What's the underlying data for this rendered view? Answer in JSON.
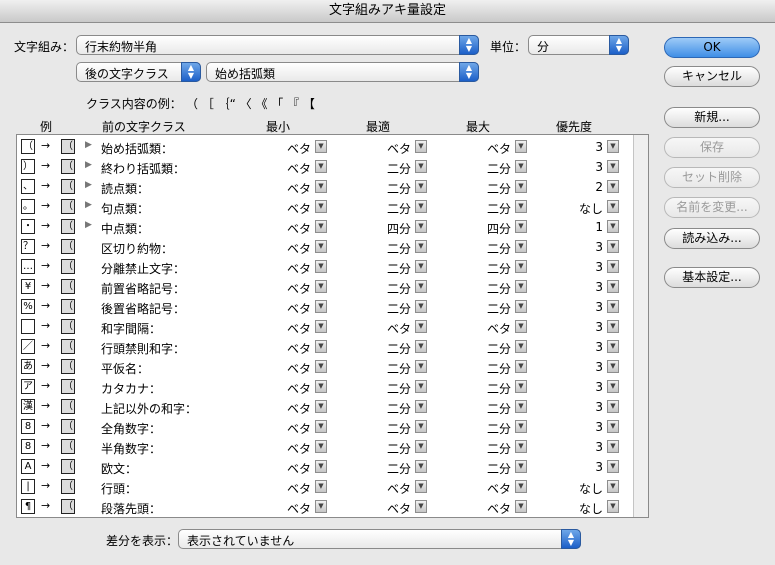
{
  "window": {
    "title": "文字組みアキ量設定"
  },
  "top": {
    "mojigumi_label": "文字組み：",
    "mojigumi_value": "行末約物半角",
    "unit_label": "単位：",
    "unit_value": "分",
    "after_class_value": "後の文字クラス",
    "class_value": "始め括弧類",
    "example_label": "クラス内容の例：",
    "example_chars": "（ ［ ｛“ 〈 《 「 『 【"
  },
  "buttons": {
    "ok": "OK",
    "cancel": "キャンセル",
    "new": "新規...",
    "save": "保存",
    "delete_set": "セット削除",
    "rename": "名前を変更...",
    "load": "読み込み...",
    "basic": "基本設定..."
  },
  "columns": {
    "example": "例",
    "prev_class": "前の文字クラス",
    "min": "最小",
    "opt": "最適",
    "max": "最大",
    "priority": "優先度"
  },
  "rows": [
    {
      "glyph": "（",
      "label": "始め括弧類：",
      "expand": true,
      "min": "ベタ",
      "opt": "ベタ",
      "max": "ベタ",
      "priority": "3"
    },
    {
      "glyph": "）",
      "label": "終わり括弧類：",
      "expand": true,
      "min": "ベタ",
      "opt": "二分",
      "max": "二分",
      "priority": "3"
    },
    {
      "glyph": "、",
      "label": "読点類：",
      "expand": true,
      "min": "ベタ",
      "opt": "二分",
      "max": "二分",
      "priority": "2"
    },
    {
      "glyph": "。",
      "label": "句点類：",
      "expand": true,
      "min": "ベタ",
      "opt": "二分",
      "max": "二分",
      "priority": "なし"
    },
    {
      "glyph": "・",
      "label": "中点類：",
      "expand": true,
      "min": "ベタ",
      "opt": "四分",
      "max": "四分",
      "priority": "1"
    },
    {
      "glyph": "？",
      "label": "区切り約物：",
      "expand": false,
      "min": "ベタ",
      "opt": "二分",
      "max": "二分",
      "priority": "3"
    },
    {
      "glyph": "…",
      "label": "分離禁止文字：",
      "expand": false,
      "min": "ベタ",
      "opt": "二分",
      "max": "二分",
      "priority": "3"
    },
    {
      "glyph": "¥",
      "label": "前置省略記号：",
      "expand": false,
      "min": "ベタ",
      "opt": "二分",
      "max": "二分",
      "priority": "3"
    },
    {
      "glyph": "%",
      "label": "後置省略記号：",
      "expand": false,
      "min": "ベタ",
      "opt": "二分",
      "max": "二分",
      "priority": "3"
    },
    {
      "glyph": "",
      "label": "和字間隔：",
      "expand": false,
      "min": "ベタ",
      "opt": "ベタ",
      "max": "ベタ",
      "priority": "3"
    },
    {
      "glyph": "／",
      "label": "行頭禁則和字：",
      "expand": false,
      "min": "ベタ",
      "opt": "二分",
      "max": "二分",
      "priority": "3"
    },
    {
      "glyph": "あ",
      "label": "平仮名：",
      "expand": false,
      "min": "ベタ",
      "opt": "二分",
      "max": "二分",
      "priority": "3"
    },
    {
      "glyph": "ア",
      "label": "カタカナ：",
      "expand": false,
      "min": "ベタ",
      "opt": "二分",
      "max": "二分",
      "priority": "3"
    },
    {
      "glyph": "漢",
      "label": "上記以外の和字：",
      "expand": false,
      "min": "ベタ",
      "opt": "二分",
      "max": "二分",
      "priority": "3"
    },
    {
      "glyph": "8",
      "label": "全角数字：",
      "expand": false,
      "min": "ベタ",
      "opt": "二分",
      "max": "二分",
      "priority": "3"
    },
    {
      "glyph": "8",
      "label": "半角数字：",
      "expand": false,
      "min": "ベタ",
      "opt": "二分",
      "max": "二分",
      "priority": "3"
    },
    {
      "glyph": "A",
      "label": "欧文：",
      "expand": false,
      "min": "ベタ",
      "opt": "二分",
      "max": "二分",
      "priority": "3"
    },
    {
      "glyph": "|",
      "label": "行頭：",
      "expand": false,
      "min": "ベタ",
      "opt": "ベタ",
      "max": "ベタ",
      "priority": "なし"
    },
    {
      "glyph": "¶",
      "label": "段落先頭：",
      "expand": false,
      "min": "ベタ",
      "opt": "ベタ",
      "max": "ベタ",
      "priority": "なし"
    }
  ],
  "bottom": {
    "diff_label": "差分を表示：",
    "diff_value": "表示されていません"
  }
}
